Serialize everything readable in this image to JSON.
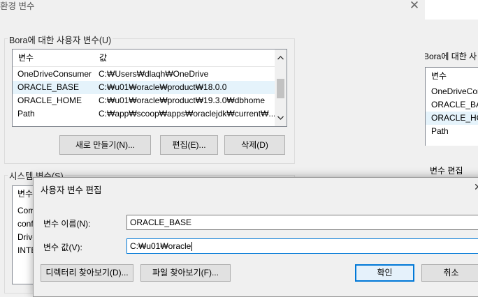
{
  "main_window": {
    "title": "환경 변수",
    "close_glyph": "✕",
    "user_vars": {
      "legend": "Bora에 대한 사용자 변수(U)",
      "headers": {
        "name": "변수",
        "value": "값"
      },
      "rows": [
        {
          "name": "OneDriveConsumer",
          "value": "C:₩Users₩dlaqh₩OneDrive"
        },
        {
          "name": "ORACLE_BASE",
          "value": "C:₩u01₩oracle₩product₩18.0.0"
        },
        {
          "name": "ORACLE_HOME",
          "value": "C:₩u01₩oracle₩product₩19.3.0₩dbhome"
        },
        {
          "name": "Path",
          "value": "C:₩app₩scoop₩apps₩oraclejdk₩current₩..."
        }
      ],
      "buttons": {
        "new": "새로 만들기(N)...",
        "edit": "편집(E)...",
        "delete": "삭제(D)"
      }
    },
    "system_vars": {
      "legend": "시스템 변수(S)",
      "header_name": "변수",
      "rows": [
        "Com",
        "conf",
        "Drive",
        "INTE"
      ]
    }
  },
  "bg_window": {
    "title": "Bora에 대한 사",
    "header": "변수",
    "rows": [
      "OneDriveCon",
      "ORACLE_BAS",
      "ORACLE_HO",
      "Path"
    ],
    "edit_title": "변수 편집"
  },
  "dialog": {
    "title": "사용자 변수 편집",
    "close_glyph": "✕",
    "name_label": "변수 이름(N):",
    "name_value": "ORACLE_BASE",
    "value_label": "변수 값(V):",
    "value_value": "C:₩u01₩oracle",
    "buttons": {
      "browse_dir": "디렉터리 찾아보기(D)...",
      "browse_file": "파일 찾아보기(F)...",
      "ok": "확인",
      "cancel": "취소"
    }
  },
  "icons": {
    "scroll_up": "chevron-up-icon",
    "scroll_down": "chevron-down-icon"
  },
  "colors": {
    "accent": "#0078d7",
    "selection": "#e5f3fb"
  }
}
